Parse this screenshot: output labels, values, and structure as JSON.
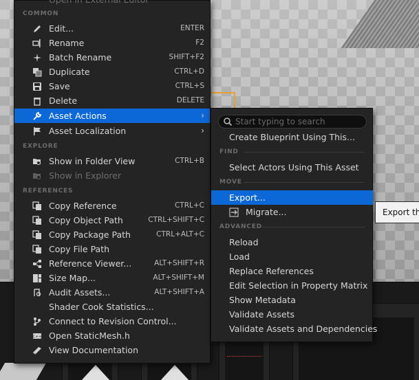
{
  "main_menu": {
    "top_item": "Open in External Editor",
    "sections": {
      "common": "COMMON",
      "explore": "EXPLORE",
      "references": "REFERENCES"
    },
    "common_items": [
      {
        "label": "Edit...",
        "shortcut": "ENTER",
        "icon": "pencil-icon"
      },
      {
        "label": "Rename",
        "shortcut": "F2",
        "icon": "rename-icon"
      },
      {
        "label": "Batch Rename",
        "shortcut": "SHIFT+F2",
        "icon": "batch-rename-icon"
      },
      {
        "label": "Duplicate",
        "shortcut": "CTRL+D",
        "icon": "duplicate-icon"
      },
      {
        "label": "Save",
        "shortcut": "CTRL+S",
        "icon": "save-icon"
      },
      {
        "label": "Delete",
        "shortcut": "DELETE",
        "icon": "trash-icon"
      },
      {
        "label": "Asset Actions",
        "shortcut": "",
        "icon": "wrench-icon",
        "selected": true,
        "submenu": true
      },
      {
        "label": "Asset Localization",
        "shortcut": "",
        "icon": "flag-icon",
        "submenu": true
      }
    ],
    "explore_items": [
      {
        "label": "Show in Folder View",
        "shortcut": "CTRL+B",
        "icon": "folder-search-icon"
      },
      {
        "label": "Show in Explorer",
        "shortcut": "",
        "icon": "folder-search-icon",
        "disabled": true
      }
    ],
    "reference_items": [
      {
        "label": "Copy Reference",
        "shortcut": "CTRL+C",
        "icon": "copy-icon"
      },
      {
        "label": "Copy Object Path",
        "shortcut": "CTRL+SHIFT+C",
        "icon": "copy-icon"
      },
      {
        "label": "Copy Package Path",
        "shortcut": "CTRL+ALT+C",
        "icon": "copy-icon"
      },
      {
        "label": "Copy File Path",
        "shortcut": "",
        "icon": "copy-icon"
      },
      {
        "label": "Reference Viewer...",
        "shortcut": "ALT+SHIFT+R",
        "icon": "reference-viewer-icon"
      },
      {
        "label": "Size Map...",
        "shortcut": "ALT+SHIFT+M",
        "icon": "size-map-icon"
      },
      {
        "label": "Audit Assets...",
        "shortcut": "ALT+SHIFT+A",
        "icon": "audit-icon"
      },
      {
        "label": "Shader Cook Statistics...",
        "shortcut": "",
        "icon": "none"
      },
      {
        "label": "Connect to Revision Control...",
        "shortcut": "",
        "icon": "revision-control-icon"
      },
      {
        "label": "Open StaticMesh.h",
        "shortcut": "",
        "icon": "code-file-icon"
      },
      {
        "label": "View Documentation",
        "shortcut": "",
        "icon": "documentation-icon"
      }
    ]
  },
  "sub_menu": {
    "search_placeholder": "Start typing to search",
    "create_blueprint": "Create Blueprint Using This...",
    "sections": {
      "find": "FIND",
      "move": "MOVE",
      "advanced": "ADVANCED"
    },
    "find_items": [
      "Select Actors Using This Asset"
    ],
    "move_items": [
      {
        "label": "Export...",
        "selected": true
      },
      {
        "label": "Migrate...",
        "icon": "migrate-icon"
      }
    ],
    "advanced_items": [
      "Reload",
      "Load",
      "Replace References",
      "Edit Selection in Property Matrix",
      "Show Metadata",
      "Validate Assets",
      "Validate Assets and Dependencies"
    ]
  },
  "tooltip": {
    "text": "Export the"
  },
  "colors": {
    "menu_bg": "#242424",
    "selection": "#0c68d6",
    "section_text": "#6c6c6c",
    "item_text": "#d6d6d6"
  }
}
